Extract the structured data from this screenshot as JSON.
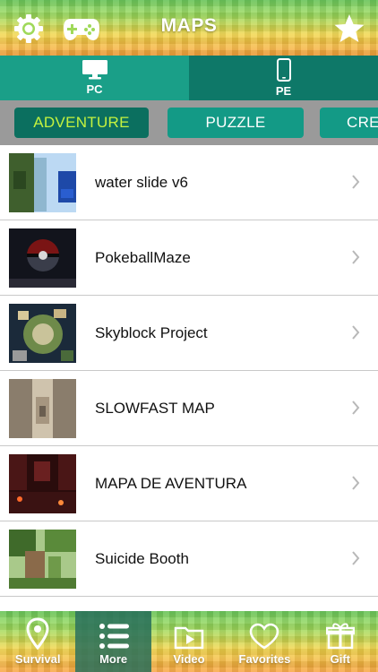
{
  "header": {
    "title": "MAPS",
    "icons": [
      "settings-gear-icon",
      "gamepad-icon",
      "star-icon"
    ]
  },
  "platforms": [
    {
      "label": "PC",
      "icon": "monitor-icon",
      "active": true
    },
    {
      "label": "PE",
      "icon": "phone-icon",
      "active": false
    }
  ],
  "categories": [
    {
      "label": "ADVENTURE",
      "active": true
    },
    {
      "label": "PUZZLE",
      "active": false
    },
    {
      "label": "CRE",
      "active": false
    }
  ],
  "maps": [
    {
      "name": "water slide v6"
    },
    {
      "name": "PokeballMaze"
    },
    {
      "name": "Skyblock Project"
    },
    {
      "name": "SLOWFAST MAP"
    },
    {
      "name": "MAPA DE AVENTURA"
    },
    {
      "name": "Suicide Booth"
    }
  ],
  "tabs": [
    {
      "label": "Survival",
      "icon": "map-pin-icon"
    },
    {
      "label": "More",
      "icon": "list-icon",
      "selected": true
    },
    {
      "label": "Video",
      "icon": "video-folder-icon"
    },
    {
      "label": "Favorites",
      "icon": "heart-icon"
    },
    {
      "label": "Gift",
      "icon": "gift-icon"
    }
  ],
  "colors": {
    "teal": "#139a86",
    "teal_dark": "#0b6f5f",
    "active_text": "#c4f23f"
  }
}
